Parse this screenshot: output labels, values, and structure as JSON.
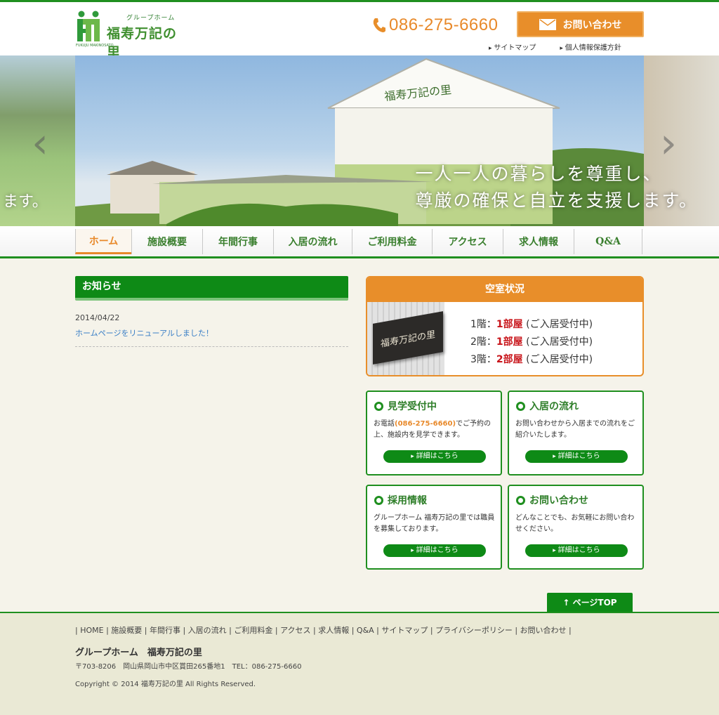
{
  "header": {
    "logo_sub": "グループホーム",
    "logo_main": "福寿万記の里",
    "logo_en": "FUKUJU MAKINOSATO",
    "tel": "086-275-6660",
    "contact_label": "お問い合わせ",
    "links": [
      "サイトマップ",
      "個人情報保護方針"
    ],
    "accent_color": "#e88e2a",
    "brand_color": "#0e8a16"
  },
  "hero": {
    "caption_line1": "一人一人の暮らしを尊重し、",
    "caption_line2": "尊厳の確保と自立を支援します。",
    "left_caption": "ます。",
    "building_sign": "福寿万記の里"
  },
  "nav": {
    "items": [
      "ホーム",
      "施設概要",
      "年間行事",
      "入居の流れ",
      "ご利用料金",
      "アクセス",
      "求人情報",
      "Q&A"
    ],
    "active": "ホーム"
  },
  "news": {
    "title": "お知らせ",
    "items": [
      {
        "date": "2014/04/22",
        "text": "ホームページをリニューアルしました！"
      }
    ]
  },
  "vacancy": {
    "title": "空室状況",
    "plate": "福寿万記の里",
    "rows": [
      {
        "floor": "1階：",
        "rooms": "1部屋",
        "status": " (ご入居受付中)"
      },
      {
        "floor": "2階：",
        "rooms": "1部屋",
        "status": " (ご入居受付中)"
      },
      {
        "floor": "3階：",
        "rooms": "2部屋",
        "status": " (ご入居受付中)"
      }
    ]
  },
  "cards": [
    {
      "title": "見学受付中",
      "text_pre": "お電話",
      "text_hl": "(086-275-6660)",
      "text_post": "でご予約の上、施設内を見学できます。",
      "button": "詳細はこちら"
    },
    {
      "title": "入居の流れ",
      "text_pre": "お問い合わせから入居までの流れをご紹介いたします。",
      "text_hl": "",
      "text_post": "",
      "button": "詳細はこちら"
    },
    {
      "title": "採用情報",
      "text_pre": "グループホーム 福寿万記の里では職員を募集しております。",
      "text_hl": "",
      "text_post": "",
      "button": "詳細はこちら"
    },
    {
      "title": "お問い合わせ",
      "text_pre": "どんなことでも、お気軽にお問い合わせください。",
      "text_hl": "",
      "text_post": "",
      "button": "詳細はこちら"
    }
  ],
  "pagetop": "↑ ページTOP",
  "footer": {
    "links": "| HOME | 施設概要 | 年間行事 | 入居の流れ | ご利用料金 | アクセス | 求人情報 | Q&A | サイトマップ | プライバシーポリシー | お問い合わせ |",
    "name": "グループホーム　福寿万記の里",
    "address": "〒703-8206　岡山県岡山市中区賞田265番地1　TEL：086-275-6660",
    "copyright": "Copyright © 2014 福寿万記の里 All Rights Reserved."
  }
}
